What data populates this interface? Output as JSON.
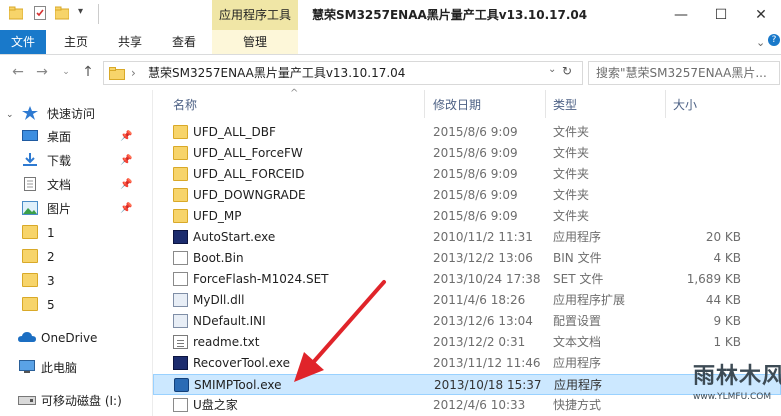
{
  "window": {
    "title": "慧荣SM3257ENAA黑片量产工具v13.10.17.04",
    "context_tab_group": "应用程序工具",
    "controls": {
      "minimize": "—",
      "maximize": "☐",
      "close": "✕"
    }
  },
  "ribbon": {
    "tabs": [
      {
        "label": "文件"
      },
      {
        "label": "主页"
      },
      {
        "label": "共享"
      },
      {
        "label": "查看"
      },
      {
        "label": "管理"
      }
    ]
  },
  "address_bar": {
    "path_segment": "慧荣SM3257ENAA黑片量产工具v13.10.17.04",
    "separator": "›"
  },
  "search": {
    "placeholder": "搜索\"慧荣SM3257ENAA黑片..."
  },
  "nav_pane": {
    "quick_access": "快速访问",
    "items": [
      {
        "label": "桌面",
        "icon": "desktop-icon",
        "pinned": true
      },
      {
        "label": "下载",
        "icon": "download-icon",
        "pinned": true
      },
      {
        "label": "文档",
        "icon": "documents-icon",
        "pinned": true
      },
      {
        "label": "图片",
        "icon": "pictures-icon",
        "pinned": true
      },
      {
        "label": "1",
        "icon": "folder-icon"
      },
      {
        "label": "2",
        "icon": "folder-icon"
      },
      {
        "label": "3",
        "icon": "folder-icon"
      },
      {
        "label": "5",
        "icon": "folder-icon"
      }
    ],
    "onedrive": "OneDrive",
    "this_pc": "此电脑",
    "removable": "可移动磁盘 (I:)",
    "pin_glyph": "📌"
  },
  "columns": {
    "name": "名称",
    "modified": "修改日期",
    "type": "类型",
    "size": "大小"
  },
  "files": [
    {
      "name": "UFD_ALL_DBF",
      "modified": "2015/8/6 9:09",
      "type": "文件夹",
      "size": "",
      "icon": "folder-icon"
    },
    {
      "name": "UFD_ALL_ForceFW",
      "modified": "2015/8/6 9:09",
      "type": "文件夹",
      "size": "",
      "icon": "folder-icon"
    },
    {
      "name": "UFD_ALL_FORCEID",
      "modified": "2015/8/6 9:09",
      "type": "文件夹",
      "size": "",
      "icon": "folder-icon"
    },
    {
      "name": "UFD_DOWNGRADE",
      "modified": "2015/8/6 9:09",
      "type": "文件夹",
      "size": "",
      "icon": "folder-icon"
    },
    {
      "name": "UFD_MP",
      "modified": "2015/8/6 9:09",
      "type": "文件夹",
      "size": "",
      "icon": "folder-icon"
    },
    {
      "name": "AutoStart.exe",
      "modified": "2010/11/2 11:31",
      "type": "应用程序",
      "size": "20 KB",
      "icon": "app-icon"
    },
    {
      "name": "Boot.Bin",
      "modified": "2013/12/2 13:06",
      "type": "BIN 文件",
      "size": "4 KB",
      "icon": "file-icon"
    },
    {
      "name": "ForceFlash-M1024.SET",
      "modified": "2013/10/24 17:38",
      "type": "SET 文件",
      "size": "1,689 KB",
      "icon": "file-icon"
    },
    {
      "name": "MyDll.dll",
      "modified": "2011/4/6 18:26",
      "type": "应用程序扩展",
      "size": "44 KB",
      "icon": "dll-icon"
    },
    {
      "name": "NDefault.INI",
      "modified": "2013/12/6 13:04",
      "type": "配置设置",
      "size": "9 KB",
      "icon": "ini-icon"
    },
    {
      "name": "readme.txt",
      "modified": "2013/12/2 0:31",
      "type": "文本文档",
      "size": "1 KB",
      "icon": "text-icon"
    },
    {
      "name": "RecoverTool.exe",
      "modified": "2013/11/12 11:46",
      "type": "应用程序",
      "size": "",
      "icon": "app-icon"
    },
    {
      "name": "SMIMPTool.exe",
      "modified": "2013/10/18 15:37",
      "type": "应用程序",
      "size": "",
      "icon": "smimp-icon",
      "selected": true
    },
    {
      "name": "U盘之家",
      "modified": "2012/4/6 10:33",
      "type": "快捷方式",
      "size": "",
      "icon": "shortcut-icon"
    }
  ],
  "watermark": {
    "main": "雨林木风",
    "sub": "www.YLMFU.COM"
  },
  "colors": {
    "accent": "#1979ca",
    "context_tab": "#f0e6a6",
    "selection": "#cce8ff",
    "arrow": "#e0242a"
  }
}
